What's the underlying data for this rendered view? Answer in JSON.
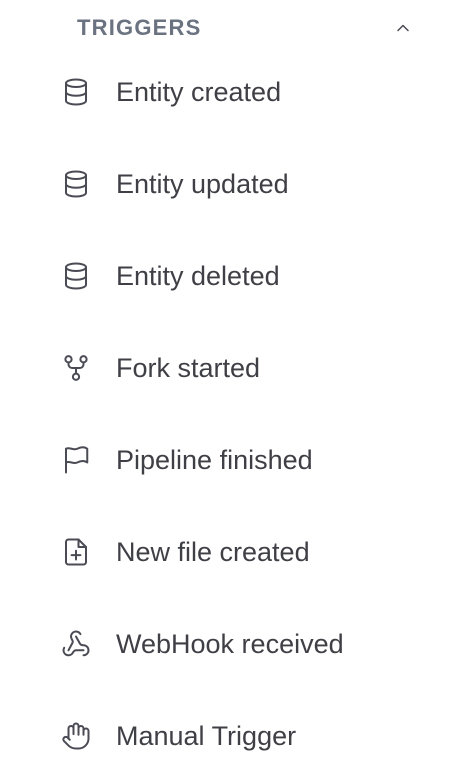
{
  "section": {
    "title": "TRIGGERS",
    "collapse_icon": "chevron-up-icon"
  },
  "items": [
    {
      "label": "Entity created",
      "icon": "database-icon"
    },
    {
      "label": "Entity updated",
      "icon": "database-icon"
    },
    {
      "label": "Entity deleted",
      "icon": "database-icon"
    },
    {
      "label": "Fork started",
      "icon": "git-fork-icon"
    },
    {
      "label": "Pipeline finished",
      "icon": "flag-icon"
    },
    {
      "label": "New file created",
      "icon": "file-plus-icon"
    },
    {
      "label": "WebHook received",
      "icon": "webhook-icon"
    },
    {
      "label": "Manual Trigger",
      "icon": "hand-icon"
    }
  ],
  "colors": {
    "text": "#3f3f46",
    "header": "#6b7280",
    "icon": "#4b4b55",
    "background": "#ffffff"
  }
}
